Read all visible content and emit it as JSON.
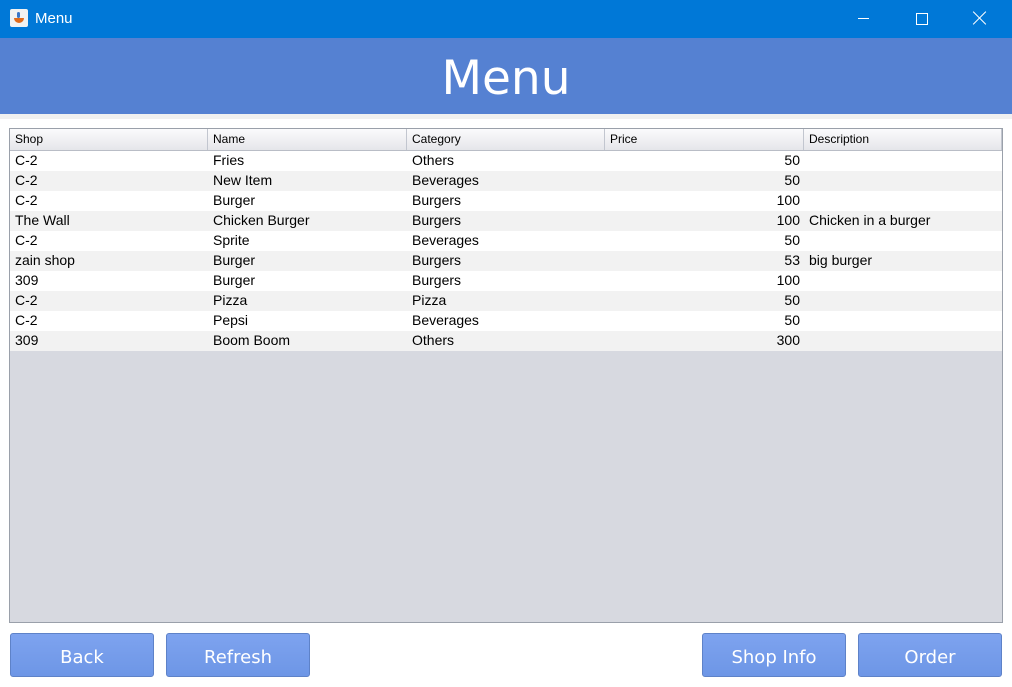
{
  "window": {
    "title": "Menu",
    "controls": [
      "minimize",
      "maximize",
      "close"
    ]
  },
  "header": {
    "title": "Menu"
  },
  "table": {
    "columns": [
      "Shop",
      "Name",
      "Category",
      "Price",
      "Description"
    ],
    "rows": [
      {
        "shop": "C-2",
        "name": "Fries",
        "category": "Others",
        "price": "50",
        "description": ""
      },
      {
        "shop": "C-2",
        "name": "New Item",
        "category": "Beverages",
        "price": "50",
        "description": ""
      },
      {
        "shop": "C-2",
        "name": "Burger",
        "category": "Burgers",
        "price": "100",
        "description": ""
      },
      {
        "shop": "The Wall",
        "name": "Chicken Burger",
        "category": "Burgers",
        "price": "100",
        "description": "Chicken in a burger"
      },
      {
        "shop": "C-2",
        "name": "Sprite",
        "category": "Beverages",
        "price": "50",
        "description": ""
      },
      {
        "shop": "zain shop",
        "name": "Burger",
        "category": "Burgers",
        "price": "53",
        "description": "big burger"
      },
      {
        "shop": "309",
        "name": "Burger",
        "category": "Burgers",
        "price": "100",
        "description": ""
      },
      {
        "shop": "C-2",
        "name": "Pizza",
        "category": "Pizza",
        "price": "50",
        "description": ""
      },
      {
        "shop": "C-2",
        "name": "Pepsi",
        "category": "Beverages",
        "price": "50",
        "description": ""
      },
      {
        "shop": "309",
        "name": "Boom Boom",
        "category": "Others",
        "price": "300",
        "description": ""
      }
    ]
  },
  "buttons": {
    "back": "Back",
    "refresh": "Refresh",
    "shop_info": "Shop Info",
    "order": "Order"
  },
  "colors": {
    "titlebar": "#0078d7",
    "header": "#5581d2",
    "button": "#7ea3ef",
    "table_bg": "#d7d9e0"
  },
  "icons": {
    "app": "java-cup-icon"
  }
}
